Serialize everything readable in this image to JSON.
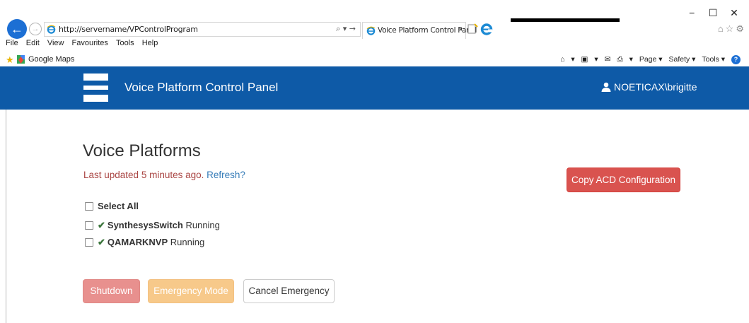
{
  "browser": {
    "url": "http://servername/VPControlProgram",
    "search_arrows": "⌕ ▾ →",
    "tab_title": "Voice Platform Control Panel",
    "tab_close": "×",
    "menu": [
      "File",
      "Edit",
      "View",
      "Favourites",
      "Tools",
      "Help"
    ],
    "favourite_label": "Google Maps",
    "command_bar": [
      "▾",
      "▾",
      "▾",
      "Page ▾",
      "Safety ▾",
      "Tools ▾"
    ],
    "help_glyph": "?",
    "window_controls": [
      "−",
      "☐",
      "✕"
    ]
  },
  "header": {
    "title": "Voice Platform Control Panel",
    "user": "NOETICAX\\brigitte",
    "background": "#0e5aa7"
  },
  "main": {
    "title": "Voice Platforms",
    "updated_text": "Last updated 5 minutes ago.",
    "refresh_label": "Refresh?",
    "copy_button": "Copy ACD Configuration",
    "select_all": "Select All",
    "platforms": [
      {
        "name": "SynthesysSwitch",
        "status": "Running"
      },
      {
        "name": "QAMARKNVP",
        "status": "Running"
      }
    ],
    "buttons": {
      "shutdown": "Shutdown",
      "emergency": "Emergency Mode",
      "cancel": "Cancel Emergency"
    }
  },
  "colors": {
    "danger": "#d9534f",
    "warning": "#f0ad4e",
    "success": "#3c763d",
    "error_text": "#a94442",
    "link": "#337ab7"
  },
  "icons": {
    "back": "arrow-left-icon",
    "forward": "arrow-right-icon",
    "user": "user-icon",
    "check": "checkmark-icon"
  }
}
